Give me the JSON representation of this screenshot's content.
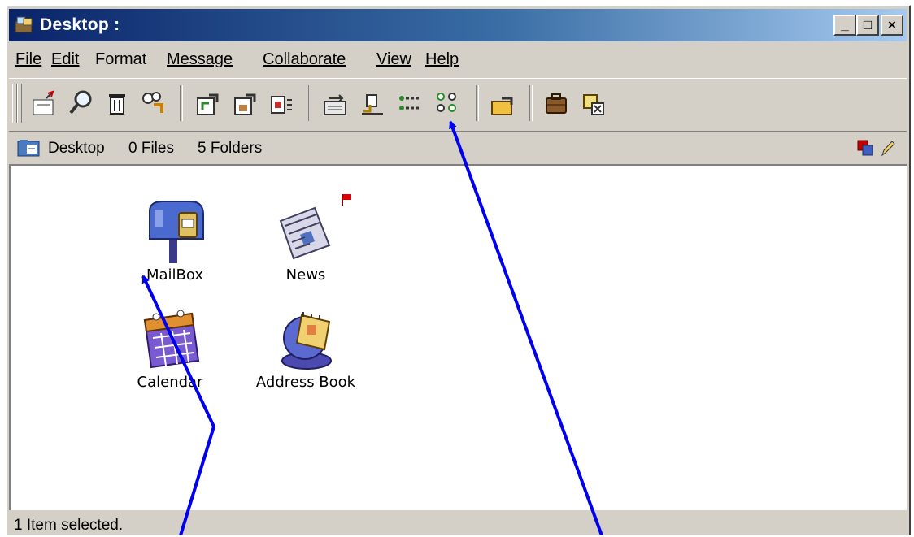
{
  "window": {
    "title": "Desktop :",
    "buttons": {
      "minimize": "_",
      "maximize": "□",
      "close": "×"
    }
  },
  "menu": [
    "File",
    "Edit",
    "Format",
    "Message",
    "Collaborate",
    "View",
    "Help"
  ],
  "toolbar": {
    "buttons": [
      "compose-icon",
      "find-icon",
      "trash-icon",
      "connect-icon",
      "move-up-icon",
      "move-out-icon",
      "document-icon",
      "forward-icon",
      "sign-icon",
      "list-view-icon",
      "people-view-icon",
      "folder-up-icon",
      "briefcase-icon",
      "close-window-icon"
    ]
  },
  "pathbar": {
    "location": "Desktop",
    "files": "0 Files",
    "folders": "5 Folders"
  },
  "desktop_items": [
    {
      "label": "MailBox",
      "icon": "mailbox-icon"
    },
    {
      "label": "News",
      "icon": "news-icon",
      "flagged": true
    },
    {
      "label": "Calendar",
      "icon": "calendar-icon"
    },
    {
      "label": "Address Book",
      "icon": "address-book-icon"
    }
  ],
  "status": {
    "text": "1 Item selected."
  },
  "colors": {
    "title_bar_start": "#0a246a",
    "title_bar_end": "#a6caf0",
    "chrome": "#d4d0c8",
    "annotation_arrow": "#0000ee"
  }
}
